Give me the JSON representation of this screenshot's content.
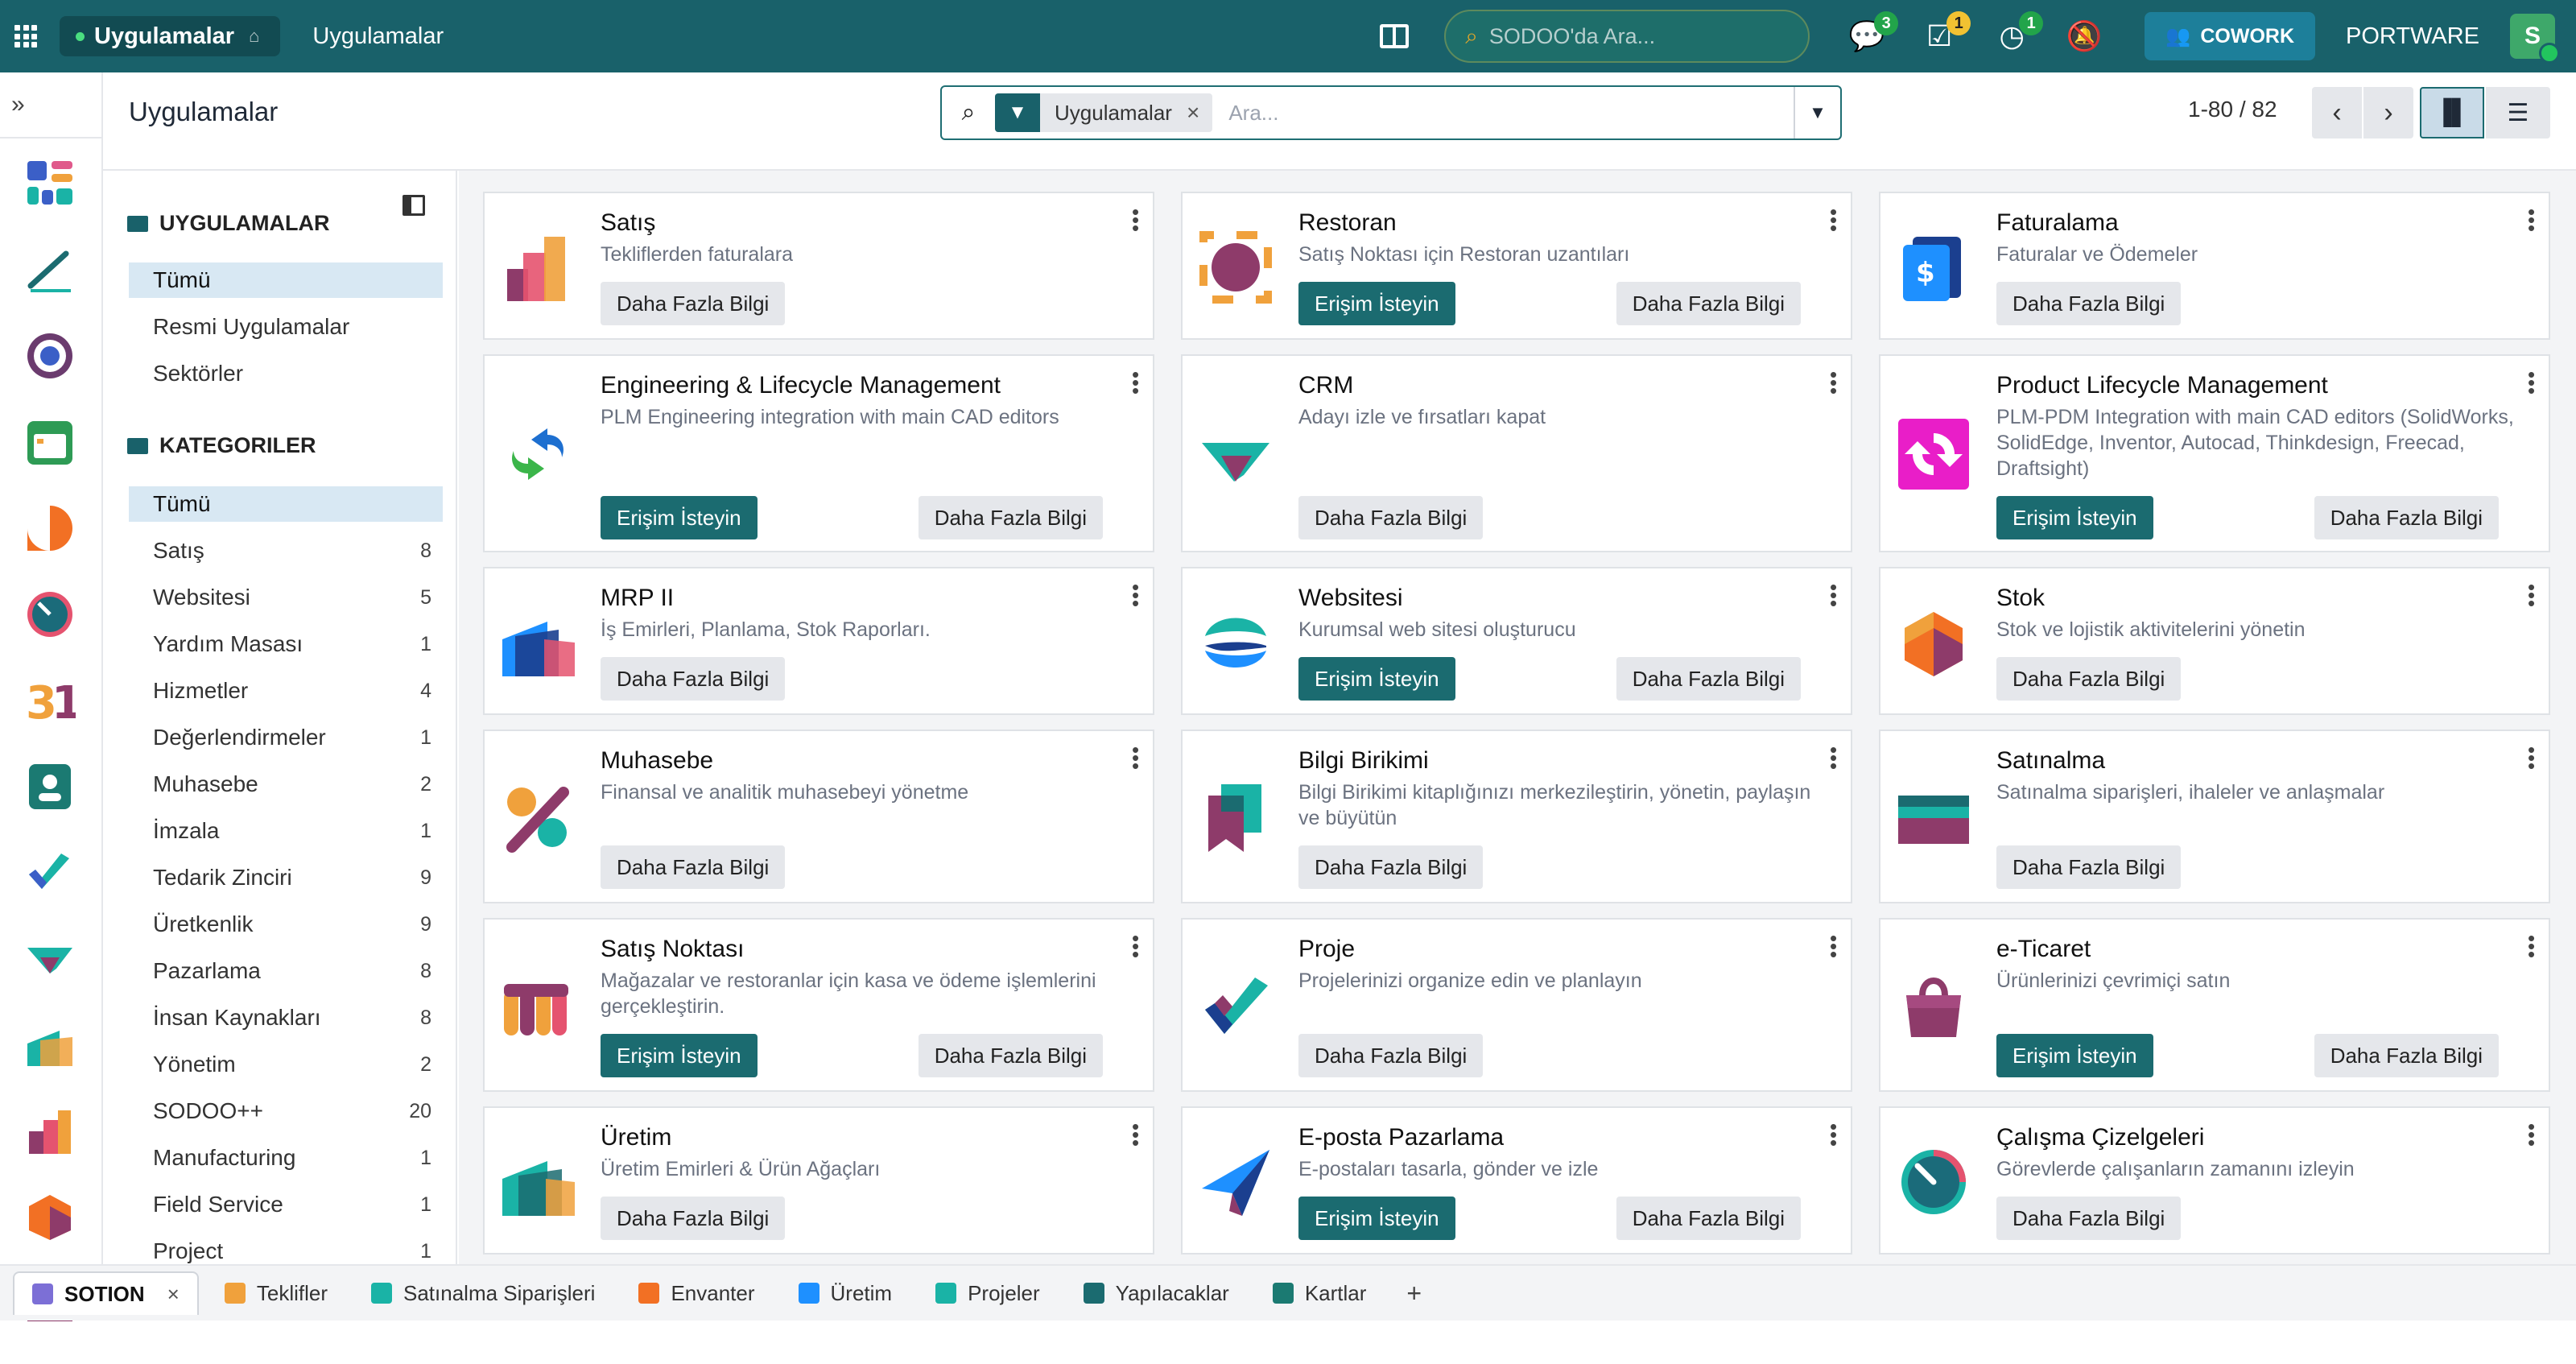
{
  "topbar": {
    "app_name": "Uygulamalar",
    "title": "Uygulamalar",
    "search_placeholder": "SODOO'da Ara...",
    "messages_count": "3",
    "activities_count": "1",
    "timer_count": "1",
    "cowork_label": "COWORK",
    "company": "PORTWARE",
    "avatar_letter": "S"
  },
  "control": {
    "page_title": "Uygulamalar",
    "facet_label": "Uygulamalar",
    "search_placeholder": "Ara...",
    "pager": "1-80 / 82"
  },
  "sidepanel": {
    "apps_heading": "UYGULAMALAR",
    "apps_items": [
      {
        "label": "Tümü"
      },
      {
        "label": "Resmi Uygulamalar"
      },
      {
        "label": "Sektörler"
      }
    ],
    "cat_heading": "KATEGORILER",
    "cat_items": [
      {
        "label": "Tümü",
        "count": ""
      },
      {
        "label": "Satış",
        "count": "8"
      },
      {
        "label": "Websitesi",
        "count": "5"
      },
      {
        "label": "Yardım Masası",
        "count": "1"
      },
      {
        "label": "Hizmetler",
        "count": "4"
      },
      {
        "label": "Değerlendirmeler",
        "count": "1"
      },
      {
        "label": "Muhasebe",
        "count": "2"
      },
      {
        "label": "İmzala",
        "count": "1"
      },
      {
        "label": "Tedarik Zinciri",
        "count": "9"
      },
      {
        "label": "Üretkenlik",
        "count": "9"
      },
      {
        "label": "Pazarlama",
        "count": "8"
      },
      {
        "label": "İnsan Kaynakları",
        "count": "8"
      },
      {
        "label": "Yönetim",
        "count": "2"
      },
      {
        "label": "SODOO++",
        "count": "20"
      },
      {
        "label": "Manufacturing",
        "count": "1"
      },
      {
        "label": "Field Service",
        "count": "1"
      },
      {
        "label": "Project",
        "count": "1"
      }
    ]
  },
  "buttons": {
    "request_access": "Erişim İsteyin",
    "learn_more": "Daha Fazla Bilgi"
  },
  "apps": [
    {
      "name": "Satış",
      "desc": "Tekliflerden faturalara",
      "icon": "sales-icon"
    },
    {
      "name": "Restoran",
      "desc": "Satış Noktası için Restoran uzantıları",
      "icon": "restaurant-icon"
    },
    {
      "name": "Faturalama",
      "desc": "Faturalar ve Ödemeler",
      "icon": "invoicing-icon"
    },
    {
      "name": "Engineering & Lifecycle Management",
      "desc": "PLM Engineering integration with main CAD editors",
      "icon": "plm-arrows-icon"
    },
    {
      "name": "CRM",
      "desc": "Adayı izle ve fırsatları kapat",
      "icon": "crm-icon"
    },
    {
      "name": "Product Lifecycle Management",
      "desc": "PLM-PDM Integration with main CAD editors (SolidWorks, SolidEdge, Inventor, Autocad, Thinkdesign, Freecad, Draftsight)",
      "icon": "plm-sync-icon"
    },
    {
      "name": "MRP II",
      "desc": "İş Emirleri, Planlama, Stok Raporları.",
      "icon": "mrp-icon"
    },
    {
      "name": "Websitesi",
      "desc": "Kurumsal web sitesi oluşturucu",
      "icon": "website-icon"
    },
    {
      "name": "Stok",
      "desc": "Stok ve lojistik aktivitelerini yönetin",
      "icon": "inventory-icon"
    },
    {
      "name": "Muhasebe",
      "desc": "Finansal ve analitik muhasebeyi yönetme",
      "icon": "accounting-icon"
    },
    {
      "name": "Bilgi Birikimi",
      "desc": "Bilgi Birikimi kitaplığınızı merkezileştirin, yönetin, paylaşın ve büyütün",
      "icon": "knowledge-icon"
    },
    {
      "name": "Satınalma",
      "desc": "Satınalma siparişleri, ihaleler ve anlaşmalar",
      "icon": "purchase-icon"
    },
    {
      "name": "Satış Noktası",
      "desc": "Mağazalar ve restoranlar için kasa ve ödeme işlemlerini gerçekleştirin.",
      "icon": "pos-icon"
    },
    {
      "name": "Proje",
      "desc": "Projelerinizi organize edin ve planlayın",
      "icon": "project-icon"
    },
    {
      "name": "e-Ticaret",
      "desc": "Ürünlerinizi çevrimiçi satın",
      "icon": "ecommerce-icon"
    },
    {
      "name": "Üretim",
      "desc": "Üretim Emirleri & Ürün Ağaçları",
      "icon": "manufacturing-icon"
    },
    {
      "name": "E-posta Pazarlama",
      "desc": "E-postaları tasarla, gönder ve izle",
      "icon": "email-marketing-icon"
    },
    {
      "name": "Çalışma Çizelgeleri",
      "desc": "Görevlerde çalışanların zamanını izleyin",
      "icon": "timesheet-icon"
    }
  ],
  "bottom_tabs": [
    {
      "label": "SOTION"
    },
    {
      "label": "Teklifler"
    },
    {
      "label": "Satınalma Siparişleri"
    },
    {
      "label": "Envanter"
    },
    {
      "label": "Üretim"
    },
    {
      "label": "Projeler"
    },
    {
      "label": "Yapılacaklar"
    },
    {
      "label": "Kartlar"
    }
  ]
}
